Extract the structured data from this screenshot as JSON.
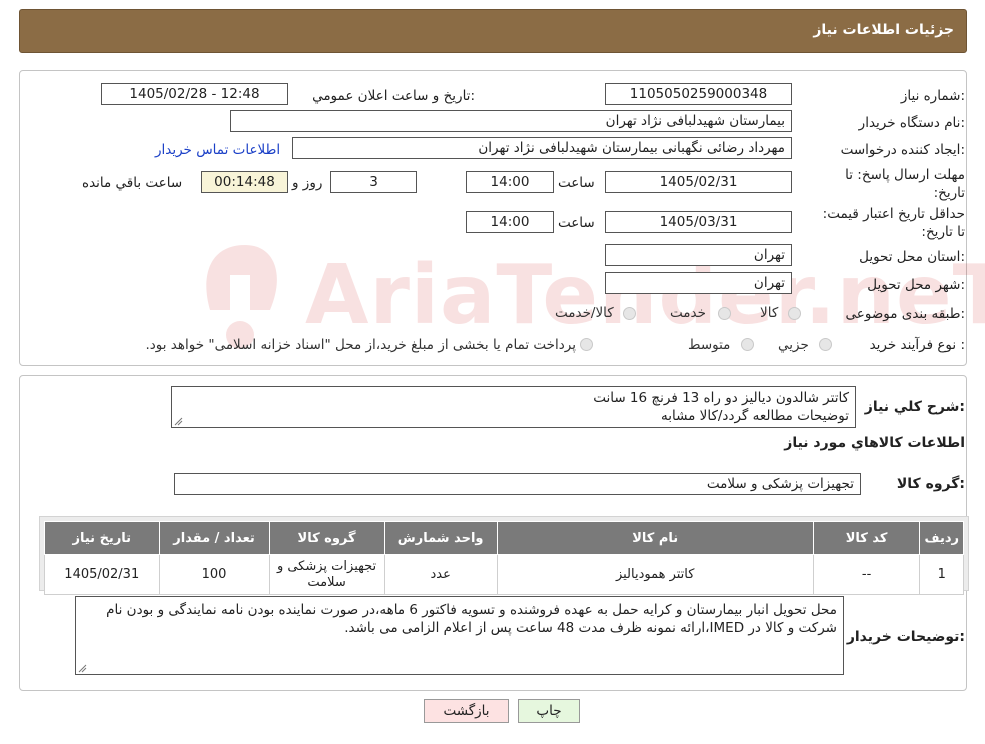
{
  "header": {
    "title": "جزئیات اطلاعات نیاز"
  },
  "form": {
    "need_number_label": "شماره نیاز:",
    "need_number": "1105050259000348",
    "announce_label": "تاریخ و ساعت اعلان عمومي:",
    "announce_value": "1405/02/28 - 12:48",
    "buyer_label": "نام دستگاه خریدار:",
    "buyer_value": "بیمارستان شهیدلبافی نژاد تهران",
    "creator_label": "ایجاد کننده درخواست:",
    "creator_value": "مهرداد رضائی نگهبانی بیمارستان شهیدلبافی نژاد تهران",
    "contact_link": "اطلاعات تماس خریدار",
    "deadline_label": "مهلت ارسال پاسخ: تا تاریخ:",
    "deadline_date": "1405/02/31",
    "time_label": "ساعت",
    "deadline_time": "14:00",
    "days_value": "3",
    "days_label": "روز و",
    "remaining_value": "00:14:48",
    "remaining_label": "ساعت باقي مانده",
    "validity_label": "حداقل تاریخ اعتبار قیمت: تا تاریخ:",
    "validity_date": "1405/03/31",
    "validity_time": "14:00",
    "province_label": "استان محل تحویل:",
    "province_value": "تهران",
    "city_label": "شهر محل تحویل:",
    "city_value": "تهران",
    "category_label": "طبقه بندی موضوعی:",
    "category_options": [
      "کالا",
      "خدمت",
      "کالا/خدمت"
    ],
    "process_label": "نوع فرآیند خرید :",
    "process_options": [
      "جزیي",
      "متوسط"
    ],
    "process_note": "پرداخت تمام یا بخشی از مبلغ خرید،از محل \"اسناد خزانه اسلامی\" خواهد بود."
  },
  "summary": {
    "label": "شرح کلي نياز:",
    "line1": "کاتتر شالدون دیالیز دو راه 13 فرنچ 16 سانت",
    "line2": "توضیحات مطالعه گردد/کالا مشابه"
  },
  "goods": {
    "section_title": "اطلاعات کالاهاي مورد نياز",
    "group_label": "گروه کالا:",
    "group_value": "تجهیزات پزشکی و سلامت",
    "columns": [
      "ردیف",
      "کد کالا",
      "نام کالا",
      "واحد شمارش",
      "گروه کالا",
      "تعداد / مقدار",
      "تاریخ نیاز"
    ],
    "rows": [
      {
        "index": "1",
        "code": "--",
        "name": "کاتتر همودیالیز",
        "unit": "عدد",
        "group": "تجهیزات پزشکی و سلامت",
        "qty": "100",
        "date": "1405/02/31"
      }
    ]
  },
  "buyer_notes": {
    "label": "توضیحات خریدار:",
    "text": "محل تحویل انبار بیمارستان و کرایه حمل به عهده فروشنده و تسویه فاکتور 6 ماهه،در صورت نماینده بودن نامه نمایندگی و بودن نام شرکت و کالا در IMED،ارائه نمونه ظرف مدت 48 ساعت پس از اعلام الزامی می باشد."
  },
  "buttons": {
    "print": "چاپ",
    "back": "بازگشت"
  },
  "watermark": {
    "text": "AriaTender.neT"
  },
  "colors": {
    "header_bg": "#8b6c45",
    "table_header_bg": "#7a7a7a",
    "link": "#1a3fc7",
    "back_button_bg": "#fde2e2",
    "print_button_bg": "#e6f7de"
  }
}
